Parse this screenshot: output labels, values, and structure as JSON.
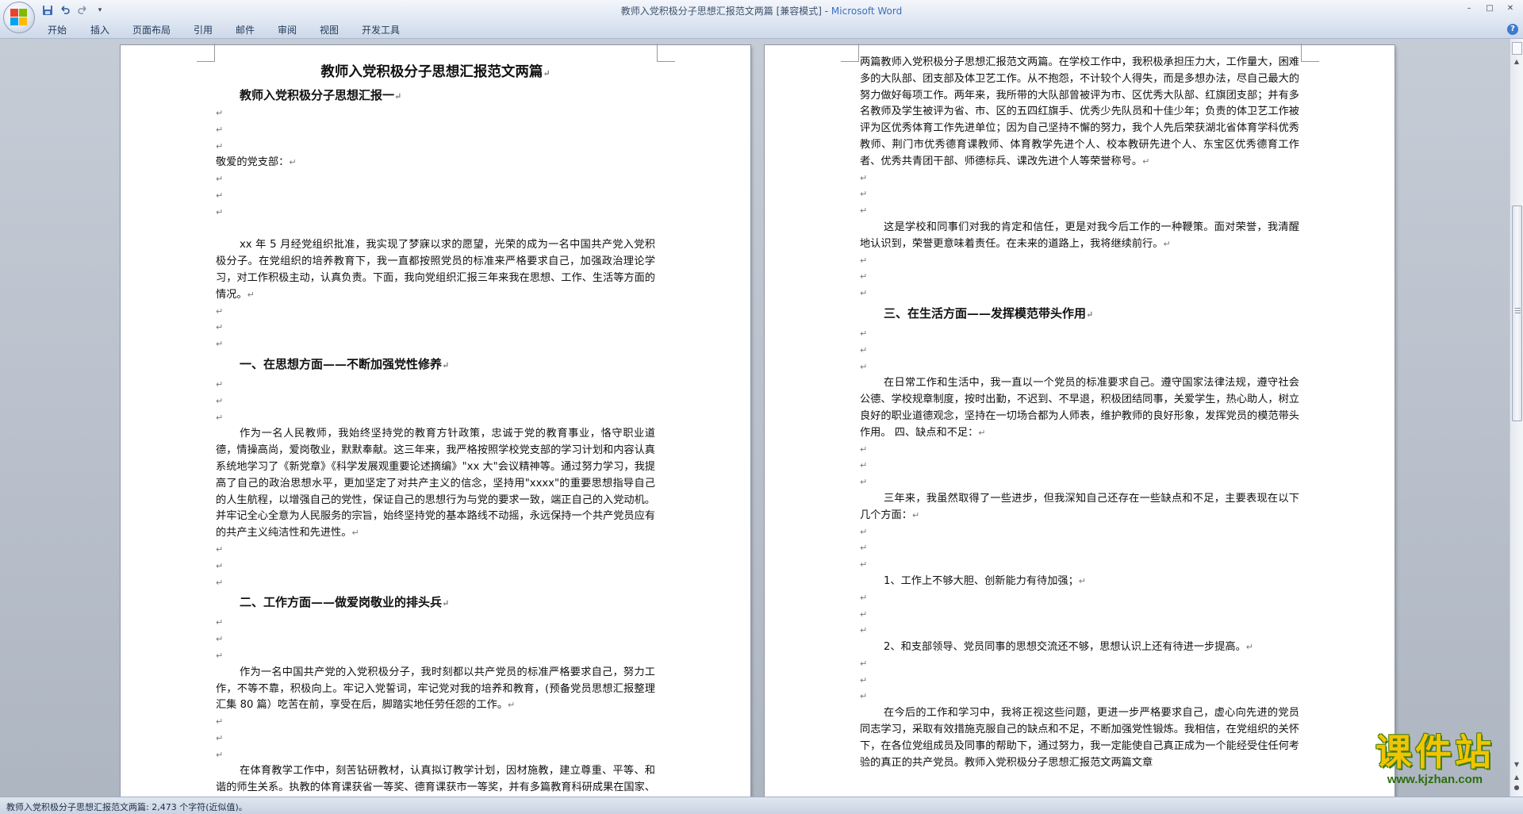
{
  "window": {
    "title": "教师入党积极分子思想汇报范文两篇 [兼容模式] - ",
    "app_name": "Microsoft Word",
    "minimize": "–",
    "maximize": "□",
    "close": "✕"
  },
  "qat": {
    "save_icon": "save-icon",
    "undo_icon": "undo-icon",
    "redo_icon": "redo-icon",
    "customize": "▾"
  },
  "ribbon": {
    "tabs": [
      "开始",
      "插入",
      "页面布局",
      "引用",
      "邮件",
      "审阅",
      "视图",
      "开发工具"
    ],
    "help": "?"
  },
  "pilcrow": "↵",
  "document": {
    "title": "教师入党积极分子思想汇报范文两篇",
    "subtitle": "教师入党积极分子思想汇报一",
    "salutation": "敬爱的党支部：",
    "para1": "xx 年 5 月经党组织批准，我实现了梦寐以求的愿望，光荣的成为一名中国共产党入党积极分子。在党组织的培养教育下，我一直都按照党员的标准来严格要求自己，加强政治理论学习，对工作积极主动，认真负责。下面，我向党组织汇报三年来我在思想、工作、生活等方面的情况。",
    "heading1": "一、在思想方面——不断加强党性修养",
    "para2": "作为一名人民教师，我始终坚持党的教育方针政策，忠诚于党的教育事业，恪守职业道德，情操高尚，爱岗敬业，默默奉献。这三年来，我严格按照学校党支部的学习计划和内容认真系统地学习了《新党章》《科学发展观重要论述摘编》\"xx 大\"会议精神等。通过努力学习，我提高了自己的政治思想水平，更加坚定了对共产主义的信念，坚持用\"xxxx\"的重要思想指导自己的人生航程，以增强自己的党性，保证自己的思想行为与党的要求一致，端正自己的入党动机。并牢记全心全意为人民服务的宗旨，始终坚持党的基本路线不动摇，永远保持一个共产党员应有的共产主义纯洁性和先进性。",
    "heading2": "二、工作方面——做爱岗敬业的排头兵",
    "para3": "作为一名中国共产党的入党积极分子，我时刻都以共产党员的标准严格要求自己，努力工作，不等不靠，积极向上。牢记入党誓词，牢记党对我的培养和教育，(预备党员思想汇报整理汇集 80 篇）吃苦在前，享受在后，脚踏实地任劳任怨的工作。",
    "para4": "在体育教学工作中，刻苦钻研教材，认真拟订教学计划，因材施教，建立尊重、平等、和谐的师生关系。执教的体育课获省一等奖、德育课获市一等奖，并有多篇教育科研成果在国家、省、市区各级报刊杂志上发表和获奖。教师入党积极分子思想汇报范文",
    "para5": "两篇教师入党积极分子思想汇报范文两篇。在学校工作中，我积极承担压力大，工作量大，困难多的大队部、团支部及体卫艺工作。从不抱怨，不计较个人得失，而是多想办法，尽自己最大的努力做好每项工作。两年来，我所带的大队部曾被评为市、区优秀大队部、红旗团支部；并有多名教师及学生被评为省、市、区的五四红旗手、优秀少先队员和十佳少年；负责的体卫艺工作被评为区优秀体育工作先进单位；因为自己坚持不懈的努力，我个人先后荣获湖北省体育学科优秀教师、荆门市优秀德育课教师、体育教学先进个人、校本教研先进个人、东宝区优秀德育工作者、优秀共青团干部、师德标兵、课改先进个人等荣誉称号。",
    "para6": "这是学校和同事们对我的肯定和信任，更是对我今后工作的一种鞭策。面对荣誉，我清醒地认识到，荣誉更意味着责任。在未来的道路上，我将继续前行。",
    "heading3": "三、在生活方面——发挥模范带头作用",
    "para7": "在日常工作和生活中，我一直以一个党员的标准要求自己。遵守国家法律法规，遵守社会公德、学校规章制度，按时出勤，不迟到、不早退，积极团结同事，关爱学生，热心助人，树立良好的职业道德观念，坚持在一切场合都为人师表，维护教师的良好形象，发挥党员的模范带头作用。 四、缺点和不足：",
    "para8": "三年来，我虽然取得了一些进步，但我深知自己还存在一些缺点和不足，主要表现在以下几个方面：",
    "item1": "1、工作上不够大胆、创新能力有待加强；",
    "item2": "2、和支部领导、党员同事的思想交流还不够，思想认识上还有待进一步提高。",
    "para9": "在今后的工作和学习中，我将正视这些问题，更进一步严格要求自己，虚心向先进的党员同志学习，采取有效措施克服自己的缺点和不足，不断加强党性锻炼。我相信，在党组织的关怀下，在各位党组成员及同事的帮助下，通过努力，我一定能使自己真正成为一个能经受住任何考验的真正的共产党员。教师入党积极分子思想汇报范文两篇文章"
  },
  "status": {
    "text": "教师入党积极分子思想汇报范文两篇: 2,473 个字符(近似值)。"
  },
  "watermark": {
    "title": "课件站",
    "url": "www.kjzhan.com"
  },
  "colors": {
    "title_app": "#3a6fbf",
    "watermark_yellow": "#f2c400",
    "watermark_green": "#2c6e0f"
  }
}
